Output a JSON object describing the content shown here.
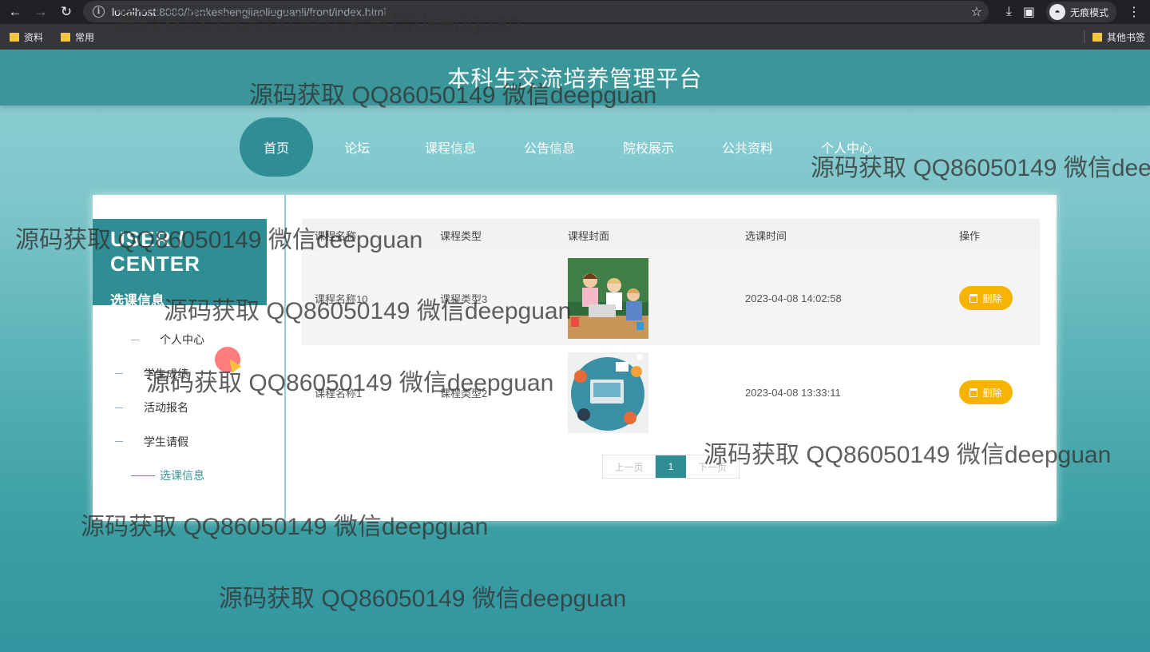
{
  "browser": {
    "url_host": "localhost",
    "url_path": ":8080/benkeshengjiaoliuguanli/front/index.html",
    "incognito_label": "无痕模式",
    "bookmarks": [
      "资料",
      "常用"
    ],
    "other_bookmarks": "其他书签"
  },
  "site": {
    "title": "本科生交流培养管理平台",
    "nav": [
      "首页",
      "论坛",
      "课程信息",
      "公告信息",
      "院校展示",
      "公共资料",
      "个人中心"
    ],
    "active_nav": "首页"
  },
  "sidebar": {
    "heading_en": "USER / CENTER",
    "heading_cn": "选课信息",
    "items": [
      {
        "label": "个人中心",
        "active": false
      },
      {
        "label": "学生成绩",
        "active": false
      },
      {
        "label": "活动报名",
        "active": false
      },
      {
        "label": "学生请假",
        "active": false
      },
      {
        "label": "选课信息",
        "active": true
      }
    ]
  },
  "table": {
    "headers": [
      "课程名称",
      "课程类型",
      "课程封面",
      "选课时间",
      "操作"
    ],
    "rows": [
      {
        "name": "课程名称10",
        "type": "课程类型3",
        "cover": "classroom-kids-image",
        "time": "2023-04-08 14:02:58",
        "action": "删除"
      },
      {
        "name": "课程名称1",
        "type": "课程类型2",
        "cover": "team-desk-illustration",
        "time": "2023-04-08 13:33:11",
        "action": "删除"
      }
    ]
  },
  "pagination": {
    "prev": "上一页",
    "current": "1",
    "next": "下一页"
  },
  "watermark": "源码获取 QQ86050149 微信deepguan",
  "colors": {
    "accent": "#2f8e93",
    "header": "#3a9699",
    "delete": "#f6b400"
  }
}
